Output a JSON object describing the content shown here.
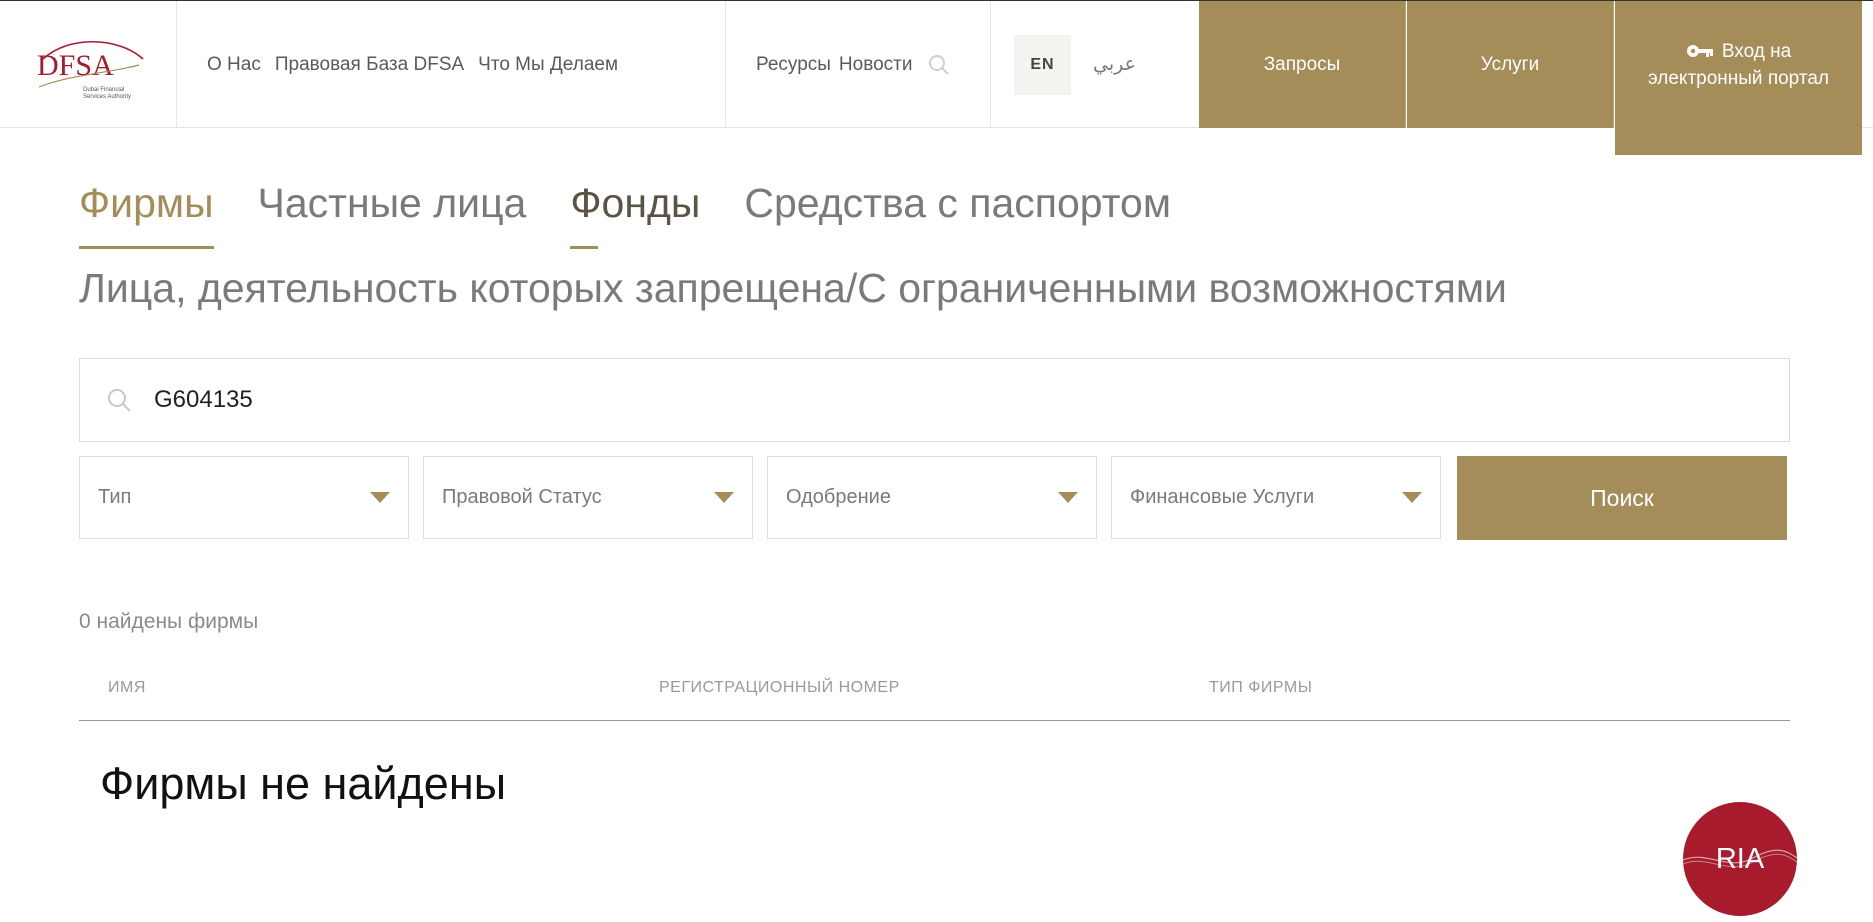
{
  "header": {
    "logo": {
      "name": "DFSA",
      "caption_line1": "Dubai Financial",
      "caption_line2": "Services Authority"
    },
    "nav": [
      "О Нас",
      "Правовая База DFSA",
      "Что Мы Делаем"
    ],
    "nav_secondary": [
      "Ресурсы",
      "Новости"
    ],
    "lang_en": "EN",
    "lang_ar": "عربي",
    "btn_requests": "Запросы",
    "btn_services": "Услуги",
    "btn_portal_line1": "Вход на",
    "btn_portal_line2": "электронный портал",
    "accent_color": "#a48d58"
  },
  "tabs": [
    "Фирмы",
    "Частные лица",
    "Фонды",
    "Средства с паспортом"
  ],
  "subheading": "Лица, деятельность которых запрещена/С ограниченными возможностями",
  "search": {
    "value": "G604135"
  },
  "filters": [
    "Тип",
    "Правовой Статус",
    "Одобрение",
    "Финансовые Услуги"
  ],
  "search_button": "Поиск",
  "results": {
    "count_text": "0 найдены фирмы",
    "columns": [
      "ИМЯ",
      "РЕГИСТРАЦИОННЫЙ НОМЕР",
      "ТИП ФИРМЫ"
    ],
    "empty_text": "Фирмы не найдены"
  },
  "badge": {
    "label": "RIA",
    "color": "#a71b2d"
  }
}
